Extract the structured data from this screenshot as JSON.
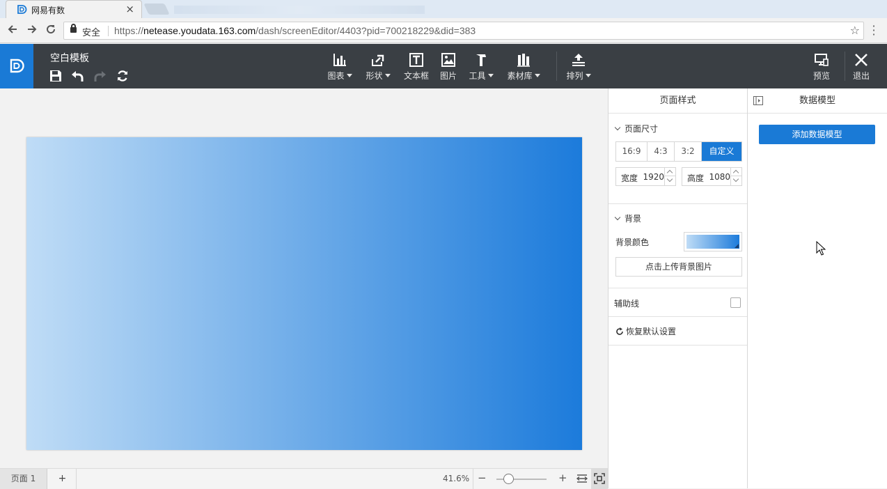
{
  "browser": {
    "tab_title": "网易有数",
    "tab_close": "×",
    "secure_label": "安全",
    "url_scheme": "https://",
    "url_host": "netease.youdata.163.com",
    "url_path": "/dash/screenEditor/4403?pid=700218229&did=383"
  },
  "header": {
    "doc_title": "空白模板",
    "tools": [
      {
        "label": "图表",
        "icon": "bar-chart-icon",
        "dropdown": true
      },
      {
        "label": "形状",
        "icon": "shape-icon",
        "dropdown": true
      },
      {
        "label": "文本框",
        "icon": "textbox-icon",
        "dropdown": false
      },
      {
        "label": "图片",
        "icon": "image-icon",
        "dropdown": false
      },
      {
        "label": "工具",
        "icon": "hammer-icon",
        "dropdown": true
      },
      {
        "label": "素材库",
        "icon": "library-icon",
        "dropdown": true
      },
      {
        "label": "排列",
        "icon": "arrange-icon",
        "dropdown": true
      }
    ],
    "preview_label": "预览",
    "exit_label": "退出"
  },
  "canvas": {
    "gradient_start": "#bfdcf6",
    "gradient_end": "#1c7bdb"
  },
  "bottom": {
    "page_tab": "页面 1",
    "add_page": "+",
    "zoom": "41.6%",
    "zoom_minus": "−",
    "zoom_plus": "+"
  },
  "style_panel": {
    "title": "页面样式",
    "size_section": "页面尺寸",
    "ratios": [
      "16:9",
      "4:3",
      "3:2",
      "自定义"
    ],
    "active_ratio": "自定义",
    "width_label": "宽度",
    "width_value": "1920",
    "height_label": "高度",
    "height_value": "1080",
    "bg_section": "背景",
    "bg_color_label": "背景颜色",
    "upload_label": "点击上传背景图片",
    "guides_label": "辅助线",
    "reset_label": "恢复默认设置"
  },
  "data_panel": {
    "title": "数据模型",
    "add_button": "添加数据模型"
  },
  "colors": {
    "accent": "#1a7ad6",
    "toolbar_bg": "#3a3f44"
  }
}
